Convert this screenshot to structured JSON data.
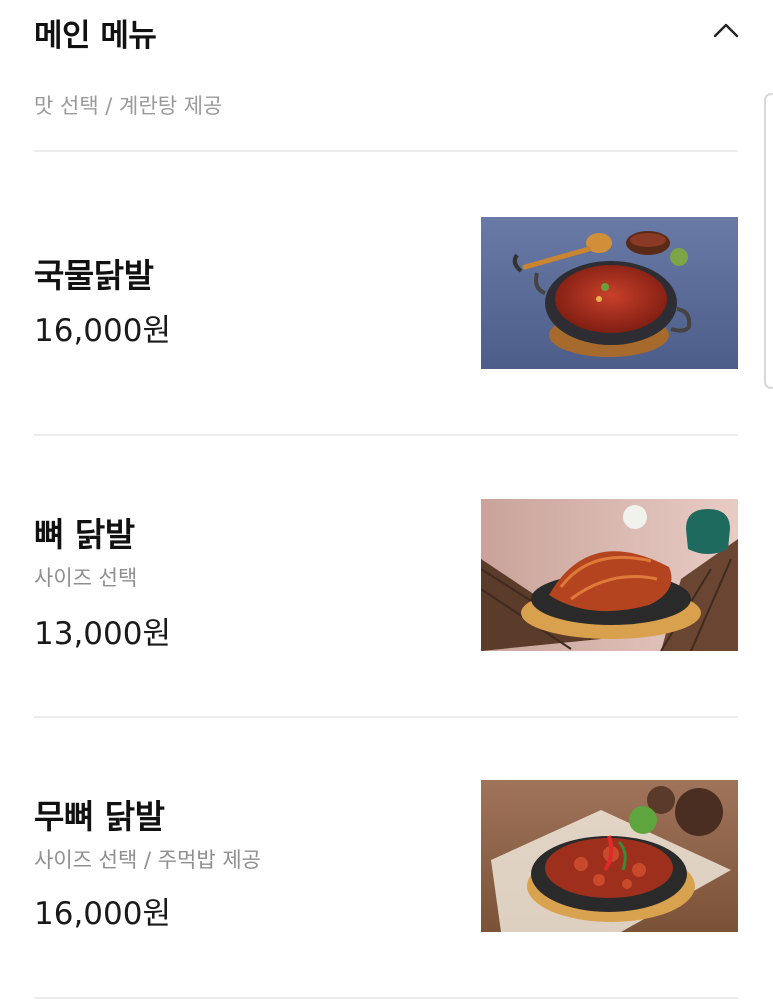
{
  "section": {
    "title": "메인 메뉴",
    "description": "맛 선택 / 계란탕 제공",
    "collapse_icon": "chevron-up-icon"
  },
  "menu_items": [
    {
      "name": "국물닭발",
      "description": "",
      "price": "16,000원",
      "photo": "spicy-soup-pan-photo"
    },
    {
      "name": "뼈 닭발",
      "description": "사이즈 선택",
      "price": "13,000원",
      "photo": "bone-chicken-feet-platter-photo"
    },
    {
      "name": "무뼈 닭발",
      "description": "사이즈 선택 / 주먹밥 제공",
      "price": "16,000원",
      "photo": "boneless-chicken-feet-platter-photo"
    }
  ],
  "colors": {
    "text": "#111111",
    "muted": "#9a9a9a",
    "divider": "#ececec"
  }
}
